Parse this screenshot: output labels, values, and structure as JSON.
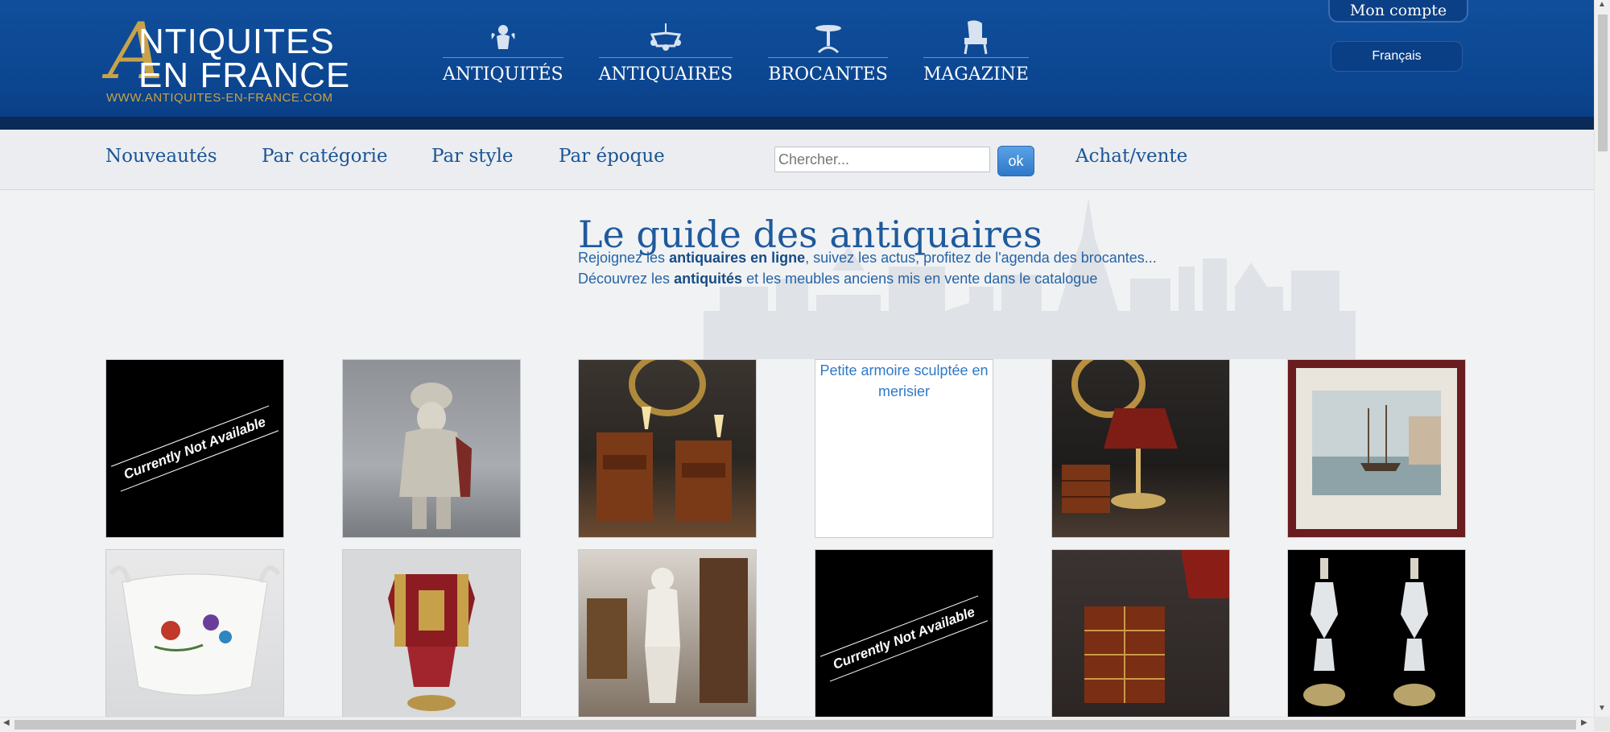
{
  "logo": {
    "big_letter": "A",
    "line1": "NTIQUITES",
    "line2": "EN FRANCE",
    "url": "WWW.ANTIQUITES-EN-FRANCE.COM"
  },
  "main_nav": {
    "items": [
      {
        "label": "ANTIQUITÉS",
        "icon": "cherub-icon"
      },
      {
        "label": "ANTIQUAIRES",
        "icon": "chandelier-icon"
      },
      {
        "label": "BROCANTES",
        "icon": "pedestal-table-icon"
      },
      {
        "label": "MAGAZINE",
        "icon": "armchair-icon"
      }
    ]
  },
  "account": {
    "label": "Mon compte"
  },
  "language": {
    "selected": "Français"
  },
  "sub_nav": {
    "links": [
      "Nouveautés",
      "Par catégorie",
      "Par style",
      "Par époque"
    ],
    "search_placeholder": "Chercher...",
    "search_button": "ok",
    "achat_vente": "Achat/vente"
  },
  "hero": {
    "title": "Le guide des antiquaires",
    "line1_pre": "Rejoignez les ",
    "line1_bold": "antiquaires en ligne",
    "line1_post": ", suivez les actus, profitez de l'agenda des brocantes...",
    "line2_pre": "Découvrez les ",
    "line2_bold": "antiquités",
    "line2_post": " et les meubles anciens mis en vente dans le catalogue"
  },
  "products": [
    {
      "type": "not-available",
      "label": "Currently Not Available"
    },
    {
      "type": "image",
      "image": "silver-figurine"
    },
    {
      "type": "image",
      "image": "bedside-tables"
    },
    {
      "type": "broken",
      "alt": "Petite armoire sculptée en merisier"
    },
    {
      "type": "image",
      "image": "bouillotte-lamp"
    },
    {
      "type": "image",
      "image": "framed-harbour-painting"
    },
    {
      "type": "image",
      "image": "porcelain-jardiniere"
    },
    {
      "type": "image",
      "image": "jeweled-seal"
    },
    {
      "type": "image",
      "image": "venus-statue"
    },
    {
      "type": "not-available",
      "label": "Currently Not Available"
    },
    {
      "type": "image",
      "image": "inlaid-cabinet"
    },
    {
      "type": "image",
      "image": "crystal-candlesticks"
    }
  ],
  "colors": {
    "header_blue": "#0c4691",
    "gold": "#c8a24a",
    "link_blue": "#1a5596"
  }
}
